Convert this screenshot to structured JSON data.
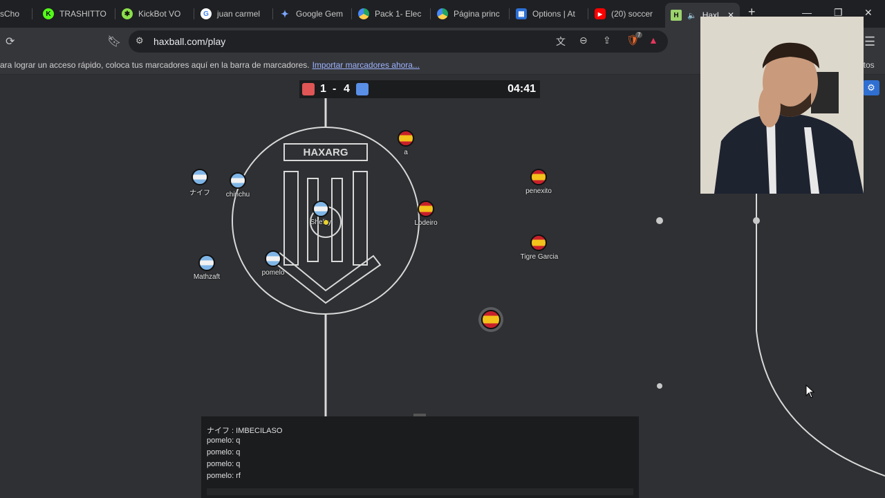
{
  "browser": {
    "tabs": [
      {
        "label": "sCho",
        "icon": "tab-favicon"
      },
      {
        "label": "TRASHITTO",
        "icon": "kick-icon"
      },
      {
        "label": "KickBot VO",
        "icon": "kickbot-icon"
      },
      {
        "label": "juan carmel",
        "icon": "google-icon"
      },
      {
        "label": "Google Gem",
        "icon": "gemini-icon"
      },
      {
        "label": "Pack 1- Elec",
        "icon": "drive-icon"
      },
      {
        "label": "Página princ",
        "icon": "drive-icon"
      },
      {
        "label": "Options | At",
        "icon": "extension-icon"
      },
      {
        "label": "(20) soccer",
        "icon": "youtube-icon"
      },
      {
        "label": "Haxl",
        "icon": "haxball-icon"
      }
    ],
    "url": "haxball.com/play",
    "bookmarks_text": "ara lograr un acceso rápido, coloca tus marcadores aquí en la barra de marcadores.",
    "bookmarks_link": "Importar marcadores ahora...",
    "bookmarks_right": "itos",
    "extension_badge": "7"
  },
  "game": {
    "score_red": "1",
    "score_dash": "-",
    "score_blue": "4",
    "timer": "04:41",
    "center_logo": "HAXARG",
    "colors": {
      "red": "#e05555",
      "blue": "#5a8fe8",
      "field": "#2e3033",
      "lines": "#d9d9d9"
    },
    "players": [
      {
        "name": "ナイフ",
        "team": "blue"
      },
      {
        "name": "chinchu",
        "team": "blue"
      },
      {
        "name": "Shelby",
        "team": "blue"
      },
      {
        "name": "Mathzaft",
        "team": "blue"
      },
      {
        "name": "pomelo",
        "team": "blue"
      },
      {
        "name": "a",
        "team": "red"
      },
      {
        "name": "Lodeiro",
        "team": "red"
      },
      {
        "name": "penexito",
        "team": "red"
      },
      {
        "name": "Tigre Garcia",
        "team": "red"
      },
      {
        "name": "",
        "team": "red"
      }
    ]
  },
  "chat": {
    "lines": [
      "ナイフ : IMBECILASO",
      "pomelo: q",
      "pomelo: q",
      "pomelo: q",
      "pomelo: rf"
    ]
  }
}
